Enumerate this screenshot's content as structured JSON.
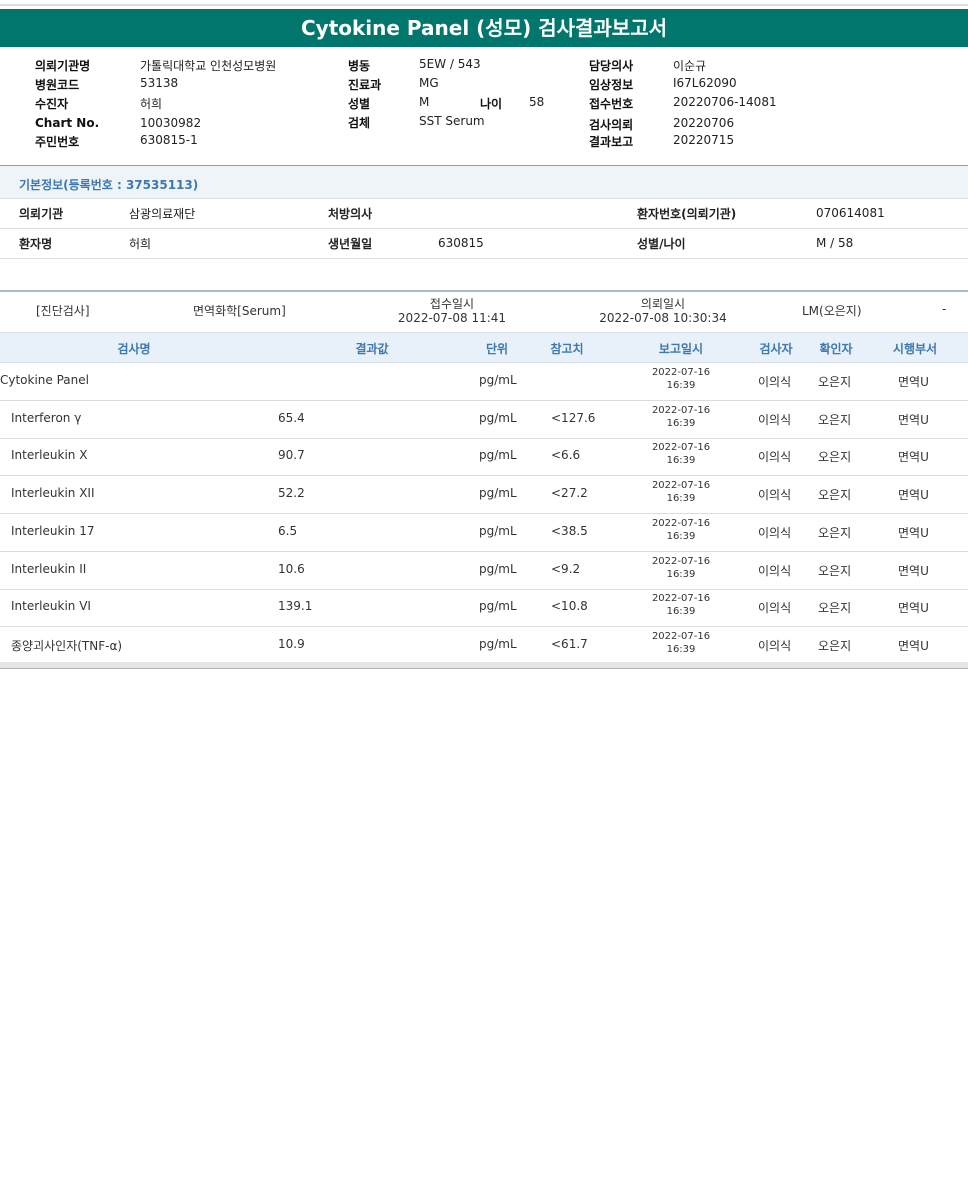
{
  "title": "Cytokine Panel (성모) 검사결과보고서",
  "header": {
    "col1": [
      {
        "label": "의뢰기관명",
        "value": "가톨릭대학교 인천성모병원"
      },
      {
        "label": "병원코드",
        "value": "53138"
      },
      {
        "label": "수진자",
        "value": "허희"
      },
      {
        "label": "Chart No.",
        "value": "10030982"
      },
      {
        "label": "주민번호",
        "value": "630815-1"
      }
    ],
    "col2": [
      {
        "label": "병동",
        "value": "5EW / 543"
      },
      {
        "label": "진료과",
        "value": "MG"
      },
      {
        "label": "성별",
        "value": "M"
      },
      {
        "label": "검체",
        "value": "SST Serum"
      }
    ],
    "age": {
      "label": "나이",
      "value": "58"
    },
    "col3": [
      {
        "label": "담당의사",
        "value": "이순규"
      },
      {
        "label": "임상정보",
        "value": "I67L62090"
      },
      {
        "label": "접수번호",
        "value": "20220706-14081"
      },
      {
        "label": "검사의뢰",
        "value": "20220706"
      },
      {
        "label": "결과보고",
        "value": "20220715"
      }
    ]
  },
  "basic": {
    "title": "기본정보(등록번호 : 37535113)",
    "row1": {
      "inst_label": "의뢰기관",
      "inst_value": "삼광의료재단",
      "doctor_label": "처방의사",
      "doctor_value": "",
      "pid_label": "환자번호(의뢰기관)",
      "pid_value": "070614081"
    },
    "row2": {
      "name_label": "환자명",
      "name_value": "허희",
      "dob_label": "생년월일",
      "dob_value": "630815",
      "sexage_label": "성별/나이",
      "sexage_value": "M / 58"
    }
  },
  "exam": {
    "category": "[진단검사]",
    "department": "면역화학[Serum]",
    "recv_label": "접수일시",
    "recv_value": "2022-07-08  11:41",
    "req_label": "의뢰일시",
    "req_value": "2022-07-08  10:30:34",
    "lm": "LM(오은지)",
    "dash": "-"
  },
  "table": {
    "headers": [
      "검사명",
      "결과값",
      "단위",
      "참고치",
      "보고일시",
      "검사자",
      "확인자",
      "시행부서"
    ],
    "rows": [
      {
        "name": "Cytokine Panel",
        "result": "",
        "unit": "pg/mL",
        "ref": "",
        "date": "2022-07-16",
        "time": "16:39",
        "tester": "이의식",
        "confirmer": "오은지",
        "dept": "면역U"
      },
      {
        "name": "Interferon γ",
        "result": "65.4",
        "unit": "pg/mL",
        "ref": "<127.6",
        "date": "2022-07-16",
        "time": "16:39",
        "tester": "이의식",
        "confirmer": "오은지",
        "dept": "면역U"
      },
      {
        "name": "Interleukin X",
        "result": "90.7",
        "unit": "pg/mL",
        "ref": "<6.6",
        "date": "2022-07-16",
        "time": "16:39",
        "tester": "이의식",
        "confirmer": "오은지",
        "dept": "면역U"
      },
      {
        "name": "Interleukin XII",
        "result": "52.2",
        "unit": "pg/mL",
        "ref": "<27.2",
        "date": "2022-07-16",
        "time": "16:39",
        "tester": "이의식",
        "confirmer": "오은지",
        "dept": "면역U"
      },
      {
        "name": "Interleukin 17",
        "result": "6.5",
        "unit": "pg/mL",
        "ref": "<38.5",
        "date": "2022-07-16",
        "time": "16:39",
        "tester": "이의식",
        "confirmer": "오은지",
        "dept": "면역U"
      },
      {
        "name": "Interleukin II",
        "result": "10.6",
        "unit": "pg/mL",
        "ref": "<9.2",
        "date": "2022-07-16",
        "time": "16:39",
        "tester": "이의식",
        "confirmer": "오은지",
        "dept": "면역U"
      },
      {
        "name": "Interleukin VI",
        "result": "139.1",
        "unit": "pg/mL",
        "ref": "<10.8",
        "date": "2022-07-16",
        "time": "16:39",
        "tester": "이의식",
        "confirmer": "오은지",
        "dept": "면역U"
      },
      {
        "name": "종양괴사인자(TNF-α)",
        "result": "10.9",
        "unit": "pg/mL",
        "ref": "<61.7",
        "date": "2022-07-16",
        "time": "16:39",
        "tester": "이의식",
        "confirmer": "오은지",
        "dept": "면역U"
      }
    ]
  }
}
